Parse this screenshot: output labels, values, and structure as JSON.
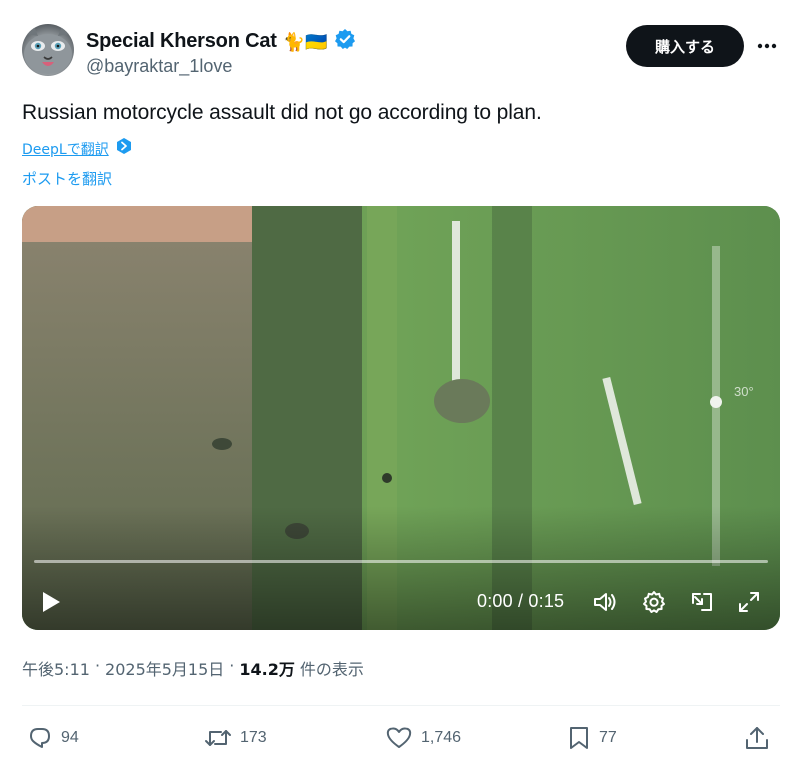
{
  "author": {
    "display_name": "Special Kherson Cat",
    "emoji": "🐈🇺🇦",
    "handle": "@bayraktar_1love",
    "verified": true
  },
  "header": {
    "buy_label": "購入する",
    "more_icon": "more-horizontal-icon"
  },
  "post": {
    "text": "Russian motorcycle assault did not go according to plan.",
    "deepl_label": "DeepLで翻訳",
    "translate_label": "ポストを翻訳"
  },
  "video": {
    "time": "0:00 / 0:15",
    "progress": 0,
    "overlay_text": "30°",
    "controls": [
      "play-icon",
      "volume-icon",
      "settings-icon",
      "picture-in-picture-icon",
      "fullscreen-icon"
    ]
  },
  "meta": {
    "time": "午後5:11",
    "separator": "·",
    "date": "2025年5月15日",
    "views_count": "14.2万",
    "views_label": "件の表示"
  },
  "actions": {
    "replies": "94",
    "reposts": "173",
    "likes": "1,746",
    "bookmarks": "77"
  },
  "colors": {
    "link": "#1d9bf0",
    "verified": "#1d9bf0",
    "secondary_text": "#536471",
    "button_bg": "#0f1419"
  }
}
